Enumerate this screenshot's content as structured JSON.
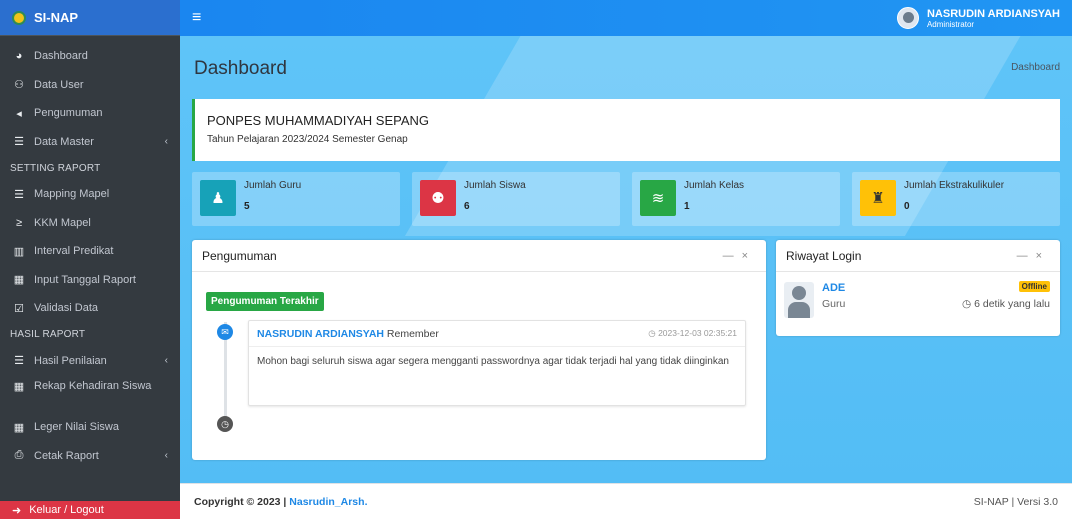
{
  "brand": {
    "name": "SI-NAP"
  },
  "sidebar": {
    "items": [
      {
        "icon": "tachometer-icon",
        "glyph": "◔",
        "label": "Dashboard"
      },
      {
        "icon": "users-icon",
        "glyph": "👥",
        "label": "Data User"
      },
      {
        "icon": "bullhorn-icon",
        "glyph": "📢",
        "label": "Pengumuman"
      },
      {
        "icon": "database-icon",
        "glyph": "☰",
        "label": "Data Master"
      }
    ],
    "section1": "SETTING RAPORT",
    "items2": [
      {
        "icon": "list-icon",
        "glyph": "☰",
        "label": "Mapping Mapel"
      },
      {
        "icon": "greater-equal-icon",
        "glyph": "≥",
        "label": "KKM Mapel"
      },
      {
        "icon": "columns-icon",
        "glyph": "▥",
        "label": "Interval Predikat"
      },
      {
        "icon": "calendar-icon",
        "glyph": "▦",
        "label": "Input Tanggal Raport"
      },
      {
        "icon": "check-square-icon",
        "glyph": "☑",
        "label": "Validasi Data"
      }
    ],
    "section2": "HASIL RAPORT",
    "items3": [
      {
        "icon": "list-icon",
        "glyph": "☰",
        "label": "Hasil Penilaian"
      },
      {
        "icon": "calendar-check-icon",
        "glyph": "▦",
        "label": "Rekap Kehadiran Siswa"
      },
      {
        "icon": "table-icon",
        "glyph": "▦",
        "label": "Leger Nilai Siswa"
      },
      {
        "icon": "print-icon",
        "glyph": "⎙",
        "label": "Cetak Raport"
      }
    ],
    "logout": "Keluar / Logout"
  },
  "topbar": {
    "user_name": "NASRUDIN ARDIANSYAH",
    "user_role": "Administrator"
  },
  "page": {
    "title": "Dashboard",
    "breadcrumb": "Dashboard"
  },
  "school": {
    "name": "PONPES MUHAMMADIYAH SEPANG",
    "year": "Tahun Pelajaran 2023/2024 Semester Genap"
  },
  "stats": [
    {
      "title": "Jumlah Guru",
      "value": "5",
      "color": "#17a2b8",
      "icon": "chalkboard-teacher-icon"
    },
    {
      "title": "Jumlah Siswa",
      "value": "6",
      "color": "#dc3545",
      "icon": "users-icon"
    },
    {
      "title": "Jumlah Kelas",
      "value": "1",
      "color": "#28a745",
      "icon": "layer-group-icon"
    },
    {
      "title": "Jumlah Ekstrakulikuler",
      "value": "0",
      "color": "#ffc107",
      "icon": "book-reader-icon"
    }
  ],
  "announcement": {
    "title": "Pengumuman",
    "badge": "Pengumuman Terakhir",
    "author": "NASRUDIN ARDIANSYAH",
    "action": "Remember",
    "time": "2023-12-03 02:35:21",
    "body": "Mohon bagi seluruh siswa agar segera mengganti passwordnya agar tidak terjadi hal yang tidak diinginkan"
  },
  "login_history": {
    "title": "Riwayat Login",
    "entries": [
      {
        "name": "ADE",
        "role": "Guru",
        "status": "Offline",
        "time": "6 detik yang lalu"
      }
    ]
  },
  "footer": {
    "copyright": "Copyright © 2023 |",
    "author": "Nasrudin_Arsh.",
    "version": "SI-NAP | Versi 3.0"
  }
}
